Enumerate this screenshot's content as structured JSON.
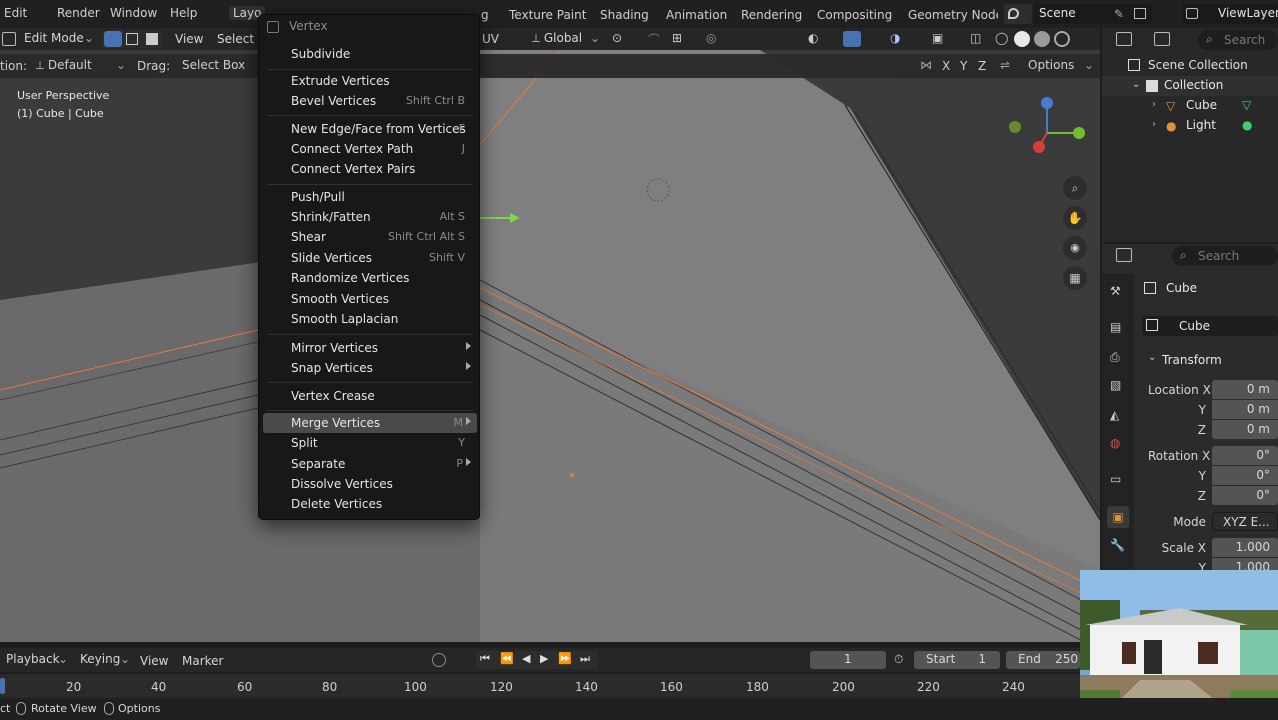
{
  "menubar": {
    "items": [
      "Edit",
      "Render",
      "Window",
      "Help",
      "Layo"
    ],
    "workspaces": [
      "g",
      "Texture Paint",
      "Shading",
      "Animation",
      "Rendering",
      "Compositing",
      "Geometry Node"
    ],
    "scene": "Scene",
    "view_layer": "ViewLayer"
  },
  "view_header": {
    "mode": "Edit Mode",
    "view": "View",
    "select": "Select",
    "uv": "UV",
    "orientation": "Global"
  },
  "tool_header": {
    "orientation_label": "tion:",
    "pivot": "Default",
    "drag_label": "Drag:",
    "drag_value": "Select Box",
    "axis_x": "X",
    "axis_y": "Y",
    "axis_z": "Z",
    "options": "Options"
  },
  "viewport": {
    "perspective": "User Perspective",
    "object_info": "(1) Cube | Cube"
  },
  "context_menu": {
    "title": "Vertex",
    "items": [
      {
        "label": "Subdivide",
        "shortcut": ""
      },
      {
        "label": "Extrude Vertices",
        "shortcut": ""
      },
      {
        "label": "Bevel Vertices",
        "shortcut": "Shift Ctrl B"
      },
      {
        "label": "New Edge/Face from Vertices",
        "shortcut": "F"
      },
      {
        "label": "Connect Vertex Path",
        "shortcut": "J"
      },
      {
        "label": "Connect Vertex Pairs",
        "shortcut": ""
      },
      {
        "label": "Push/Pull",
        "shortcut": ""
      },
      {
        "label": "Shrink/Fatten",
        "shortcut": "Alt S"
      },
      {
        "label": "Shear",
        "shortcut": "Shift Ctrl Alt S"
      },
      {
        "label": "Slide Vertices",
        "shortcut": "Shift V"
      },
      {
        "label": "Randomize Vertices",
        "shortcut": ""
      },
      {
        "label": "Smooth Vertices",
        "shortcut": ""
      },
      {
        "label": "Smooth Laplacian",
        "shortcut": ""
      },
      {
        "label": "Mirror Vertices",
        "shortcut": ""
      },
      {
        "label": "Snap Vertices",
        "shortcut": ""
      },
      {
        "label": "Vertex Crease",
        "shortcut": ""
      },
      {
        "label": "Merge Vertices",
        "shortcut": "M"
      },
      {
        "label": "Split",
        "shortcut": "Y"
      },
      {
        "label": "Separate",
        "shortcut": "P"
      },
      {
        "label": "Dissolve Vertices",
        "shortcut": ""
      },
      {
        "label": "Delete Vertices",
        "shortcut": ""
      }
    ]
  },
  "outliner": {
    "search_placeholder": "Search",
    "scene_collection": "Scene Collection",
    "collection": "Collection",
    "items": [
      "Cube",
      "Light"
    ]
  },
  "properties": {
    "search_placeholder": "Search",
    "object_name": "Cube",
    "data_name": "Cube",
    "section": "Transform",
    "location_x_label": "Location X",
    "location_x": "0 m",
    "location_y_label": "Y",
    "location_y": "0 m",
    "location_z_label": "Z",
    "location_z": "0 m",
    "rotation_x_label": "Rotation X",
    "rotation_x": "0°",
    "rotation_y_label": "Y",
    "rotation_y": "0°",
    "rotation_z_label": "Z",
    "rotation_z": "0°",
    "mode_label": "Mode",
    "mode_value": "XYZ E...",
    "scale_x_label": "Scale X",
    "scale_x": "1.000",
    "scale_y_label": "Y",
    "scale_y": "1.000"
  },
  "timeline": {
    "playback": "Playback",
    "keying": "Keying",
    "view": "View",
    "marker": "Marker",
    "current_frame": "1",
    "start_label": "Start",
    "start": "1",
    "end_label": "End",
    "end": "250",
    "ruler": [
      "20",
      "40",
      "60",
      "80",
      "100",
      "120",
      "140",
      "160",
      "180",
      "200",
      "220",
      "240"
    ]
  },
  "statusbar": {
    "left": "ct",
    "rotate_view": "Rotate View",
    "options": "Options"
  },
  "colors": {
    "accent_blue": "#4772b3",
    "menu_bg": "#181818",
    "highlight": "#4a4a4a",
    "orange_edge": "#e37b3a",
    "viewport_bg": "#3a3a3a"
  }
}
